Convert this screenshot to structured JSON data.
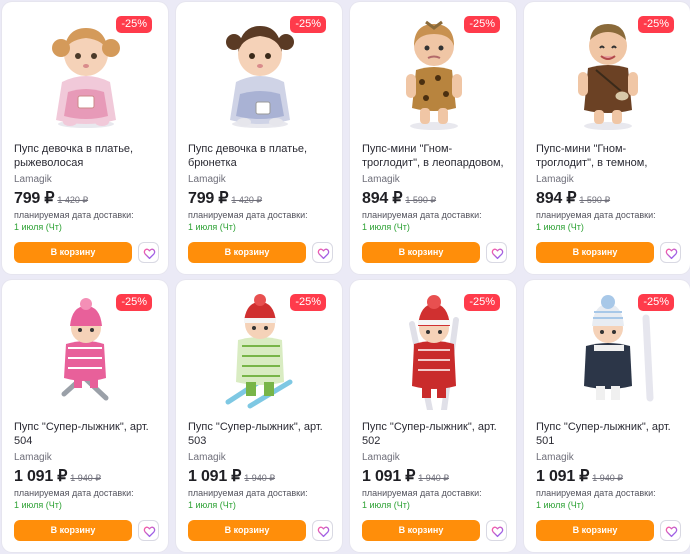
{
  "products": [
    {
      "discount": "-25%",
      "title": "Пупс девочка в платье, рыжеволосая",
      "brand": "Lamagik",
      "price": "799 ₽",
      "old_price": "1 420 ₽",
      "delivery_label": "планируемая дата доставки:",
      "delivery_date": "1 июля (Чт)",
      "cart_label": "В корзину",
      "image_icon": "doll-red-hair-dress-icon"
    },
    {
      "discount": "-25%",
      "title": "Пупс девочка в платье, брюнетка",
      "brand": "Lamagik",
      "price": "799 ₽",
      "old_price": "1 420 ₽",
      "delivery_label": "планируемая дата доставки:",
      "delivery_date": "1 июля (Чт)",
      "cart_label": "В корзину",
      "image_icon": "doll-brunette-dress-icon"
    },
    {
      "discount": "-25%",
      "title": "Пупс-мини \"Гном-троглодит\", в леопардовом, недовольный",
      "brand": "Lamagik",
      "price": "894 ₽",
      "old_price": "1 590 ₽",
      "delivery_label": "планируемая дата доставки:",
      "delivery_date": "1 июля (Чт)",
      "cart_label": "В корзину",
      "image_icon": "doll-caveman-leopard-icon"
    },
    {
      "discount": "-25%",
      "title": "Пупс-мини \"Гном-троглодит\", в темном, смеется",
      "brand": "Lamagik",
      "price": "894 ₽",
      "old_price": "1 590 ₽",
      "delivery_label": "планируемая дата доставки:",
      "delivery_date": "1 июля (Чт)",
      "cart_label": "В корзину",
      "image_icon": "doll-caveman-dark-icon"
    },
    {
      "discount": "-25%",
      "title": "Пупс \"Супер-лыжник\", арт. 504",
      "brand": "Lamagik",
      "price": "1 091 ₽",
      "old_price": "1 940 ₽",
      "delivery_label": "планируемая дата доставки:",
      "delivery_date": "1 июля (Чт)",
      "cart_label": "В корзину",
      "image_icon": "doll-skier-pink-icon"
    },
    {
      "discount": "-25%",
      "title": "Пупс \"Супер-лыжник\", арт. 503",
      "brand": "Lamagik",
      "price": "1 091 ₽",
      "old_price": "1 940 ₽",
      "delivery_label": "планируемая дата доставки:",
      "delivery_date": "1 июля (Чт)",
      "cart_label": "В корзину",
      "image_icon": "doll-skier-green-icon"
    },
    {
      "discount": "-25%",
      "title": "Пупс \"Супер-лыжник\", арт. 502",
      "brand": "Lamagik",
      "price": "1 091 ₽",
      "old_price": "1 940 ₽",
      "delivery_label": "планируемая дата доставки:",
      "delivery_date": "1 июля (Чт)",
      "cart_label": "В корзину",
      "image_icon": "doll-skier-red-icon"
    },
    {
      "discount": "-25%",
      "title": "Пупс \"Супер-лыжник\", арт. 501",
      "brand": "Lamagik",
      "price": "1 091 ₽",
      "old_price": "1 940 ₽",
      "delivery_label": "планируемая дата доставки:",
      "delivery_date": "1 июля (Чт)",
      "cart_label": "В корзину",
      "image_icon": "doll-skier-white-icon"
    }
  ],
  "colors": {
    "accent_orange": "#ff8e0a",
    "discount_red": "#ff3b4b",
    "delivery_green": "#2fa236",
    "background": "#ebeaf6",
    "favorite_gradient_start": "#ff5aa0",
    "favorite_gradient_end": "#7b61ff"
  },
  "favorite_icon": "heart-outline-icon"
}
